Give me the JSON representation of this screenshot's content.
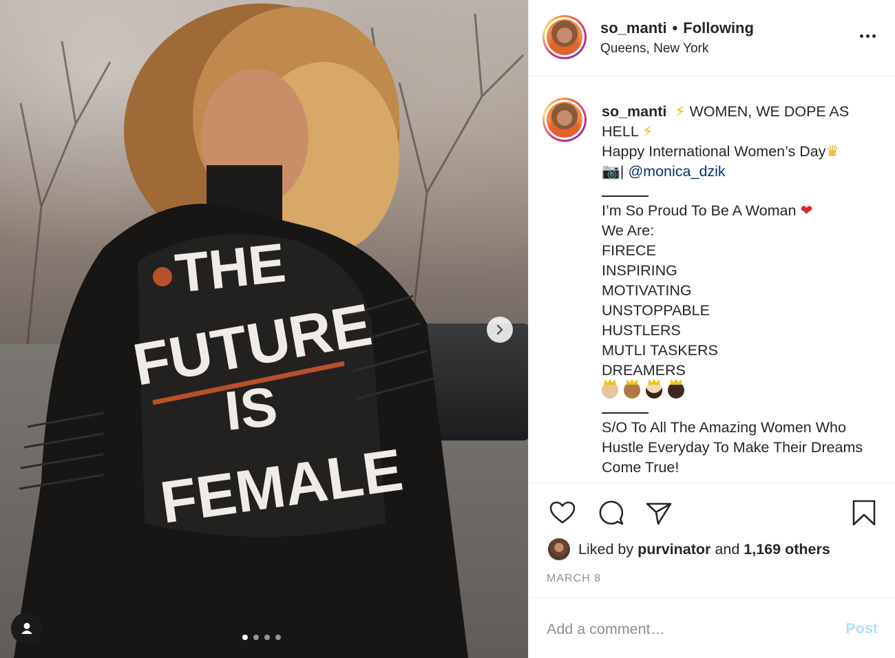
{
  "post": {
    "username": "so_manti",
    "separator": "•",
    "follow_status": "Following",
    "location": "Queens, New York",
    "caption": {
      "username": "so_manti",
      "line1_text": "WOMEN, WE DOPE AS",
      "line2_text": "HELL",
      "line3_text": "Happy International Women’s Day",
      "line4_sep": "|",
      "mention": "@monica_dzik",
      "proud": "I’m So Proud To Be A Woman",
      "we_are": "We Are:",
      "traits": [
        "FIRECE",
        "INSPIRING",
        "MOTIVATING",
        "UNSTOPPABLE",
        "HUSTLERS",
        "MUTLI TASKERS",
        "DREAMERS"
      ],
      "shoutout_1": "S/O To All The Amazing Women Who",
      "shoutout_2": "Hustle Everyday To Make Their Dreams",
      "shoutout_3": "Come True!"
    },
    "likes": {
      "prefix": "Liked by",
      "user": "purvinator",
      "joiner": "and",
      "others": "1,169 others"
    },
    "date": "MARCH 8",
    "comment": {
      "placeholder": "Add a comment…",
      "post_label": "Post"
    },
    "carousel": {
      "total": 4,
      "active": 1
    }
  },
  "photo": {
    "jacket_text": [
      "THE",
      "FUTURE",
      "IS",
      "FEMALE"
    ]
  },
  "icons": {
    "like": "heart-icon",
    "comment": "comment-icon",
    "share": "send-icon",
    "save": "bookmark-icon",
    "more": "more-icon",
    "next": "chevron-right-icon",
    "tags": "user-tag-icon"
  },
  "colors": {
    "mention": "#00376b",
    "post_disabled": "#b2dffc",
    "muted": "#8e8e8e"
  }
}
